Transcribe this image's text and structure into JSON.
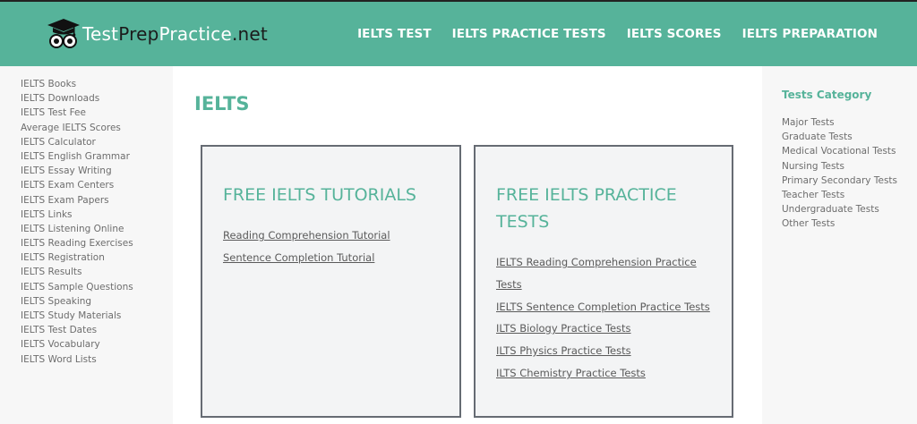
{
  "header": {
    "logo_text_a": "Test",
    "logo_text_b": "Prep",
    "logo_text_c": "Practice",
    "logo_text_d": ".net",
    "nav": [
      "IELTS TEST",
      "IELTS PRACTICE TESTS",
      "IELTS SCORES",
      "IELTS PREPARATION"
    ]
  },
  "left_sidebar": {
    "items": [
      "IELTS Books",
      "IELTS Downloads",
      "IELTS Test Fee",
      "Average IELTS Scores",
      "IELTS Calculator",
      "IELTS English Grammar",
      "IELTS Essay Writing",
      "IELTS Exam Centers",
      "IELTS Exam Papers",
      "IELTS Links",
      "IELTS Listening Online",
      "IELTS Reading Exercises",
      "IELTS Registration",
      "IELTS Results",
      "IELTS Sample Questions",
      "IELTS Speaking",
      "IELTS Study Materials",
      "IELTS Test Dates",
      "IELTS Vocabulary",
      "IELTS Word Lists"
    ]
  },
  "main": {
    "title": "IELTS",
    "cards": [
      {
        "title": "FREE IELTS TUTORIALS",
        "links": [
          "Reading Comprehension Tutorial",
          "Sentence Completion Tutorial"
        ]
      },
      {
        "title": "FREE IELTS PRACTICE TESTS",
        "links": [
          "IELTS Reading Comprehension Practice Tests",
          "IELTS Sentence Completion Practice Tests",
          "ILTS Biology Practice Tests",
          "ILTS Physics Practice Tests",
          "ILTS Chemistry Practice Tests"
        ]
      }
    ]
  },
  "right_sidebar": {
    "title": "Tests Category",
    "items": [
      "Major Tests",
      "Graduate Tests",
      "Medical Vocational Tests",
      "Nursing Tests",
      "Primary Secondary Tests",
      "Teacher Tests",
      "Undergraduate Tests",
      "Other Tests"
    ]
  },
  "colors": {
    "brand": "#56b39a",
    "sidebar_bg": "#f7f7f7",
    "card_bg": "#f3f4f5",
    "card_border": "#666b73"
  }
}
